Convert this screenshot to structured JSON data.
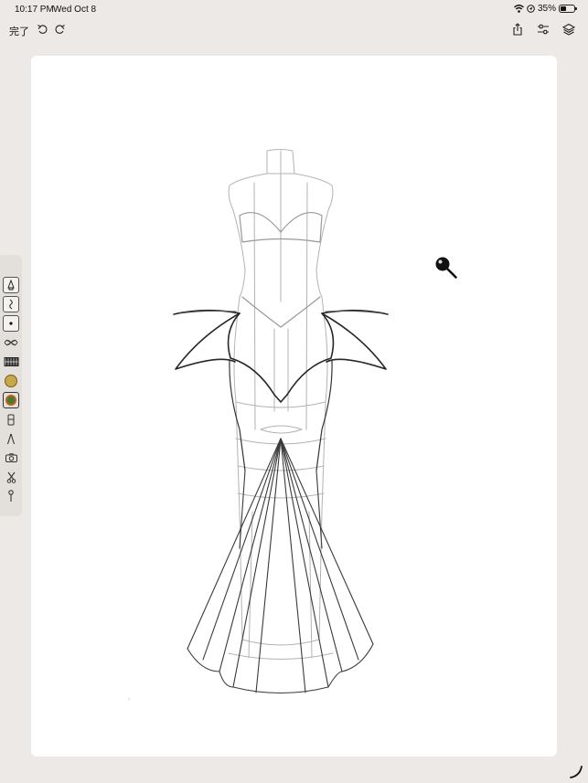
{
  "status_bar": {
    "time": "10:17 PM",
    "date": "Wed Oct 8",
    "battery_text": "35%",
    "battery_level": 0.35,
    "icons": [
      "wifi-icon",
      "location-icon",
      "battery-icon"
    ]
  },
  "toolbar": {
    "done_label": "完了",
    "left_icons": [
      "undo-icon",
      "redo-icon"
    ],
    "right_icons": [
      "share-icon",
      "adjustments-icon",
      "layers-icon"
    ]
  },
  "side_tools": {
    "items": [
      "pen-tool-icon",
      "curve-tool-icon",
      "dot-brush-icon",
      "pattern-brush-icon",
      "texture-icon",
      "color-swatch-yellow",
      "color-swatch-green",
      "eraser-icon",
      "compass-icon",
      "camera-icon",
      "scissors-icon",
      "pin-icon"
    ],
    "colors": {
      "swatch_yellow": "#c9a84b",
      "swatch_green": "#4b7a2c",
      "swatch_ring": "#b5641f"
    }
  },
  "canvas": {
    "background": "#ffffff",
    "cursor": "magnifier-cursor-icon",
    "drawing": "dress-croquis-sketch"
  }
}
